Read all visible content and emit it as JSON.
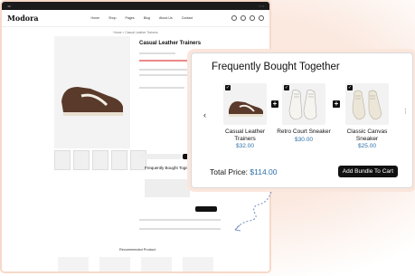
{
  "background_site": {
    "logo": "Modora",
    "nav": [
      "Home",
      "Shop",
      "Pages",
      "Blog",
      "About Us",
      "Contact"
    ],
    "breadcrumb": "Home > Casual Leather Trainers",
    "product_title": "Casual Leather Trainers",
    "fbt_title": "Frequently Bought Together",
    "recommended_title": "Recommended Product"
  },
  "bundle": {
    "title": "Frequently Bought Together",
    "products": [
      {
        "name": "Casual Leather Trainers",
        "price": "$32.00",
        "checked": true,
        "image": "brown-suede-sneaker"
      },
      {
        "name": "Retro Court Sneaker",
        "price": "$30.00",
        "checked": true,
        "image": "white-court-sneaker"
      },
      {
        "name": "Classic Canvas Sneaker",
        "price": "$25.00",
        "checked": true,
        "image": "cream-canvas-sneaker"
      }
    ],
    "total_label": "Total Price:",
    "total_value": "$114.00",
    "add_button": "Add Bundle To Cart",
    "prev_icon": "chevron-left-icon",
    "next_icon": "more-vertical-icon"
  },
  "colors": {
    "accent_price": "#2d6fa8",
    "button_bg": "#111111",
    "glow": "#fbe6dc"
  }
}
